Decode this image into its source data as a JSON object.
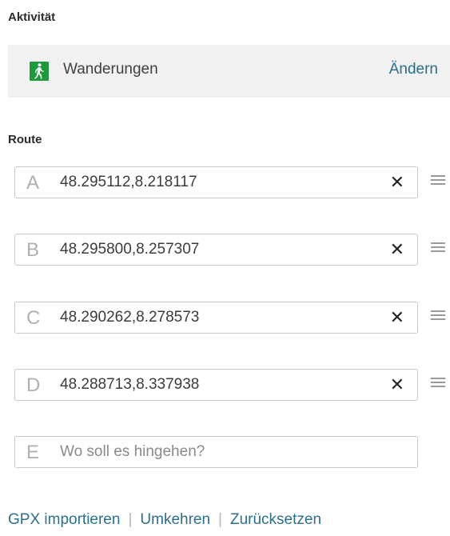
{
  "activity": {
    "heading": "Aktivität",
    "icon": "hiking-icon",
    "icon_color": "#1e9a3c",
    "label": "Wanderungen",
    "change_label": "Ändern"
  },
  "route": {
    "heading": "Route",
    "waypoints": [
      {
        "letter": "A",
        "value": "48.295112,8.218117"
      },
      {
        "letter": "B",
        "value": "48.295800,8.257307"
      },
      {
        "letter": "C",
        "value": "48.290262,8.278573"
      },
      {
        "letter": "D",
        "value": "48.288713,8.337938"
      }
    ],
    "new_waypoint": {
      "letter": "E",
      "placeholder": "Wo soll es hingehen?"
    }
  },
  "links": {
    "gpx_import": "GPX importieren",
    "reverse": "Umkehren",
    "reset": "Zurücksetzen",
    "separator": "|"
  },
  "colors": {
    "link": "#2a6f8d",
    "activity_bg": "#f1f1f1"
  }
}
